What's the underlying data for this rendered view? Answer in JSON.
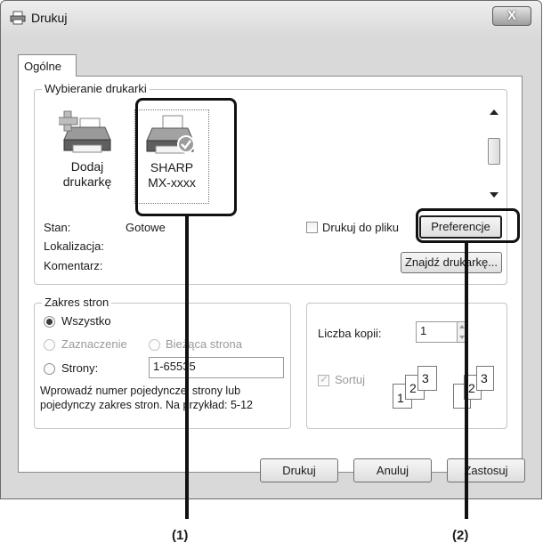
{
  "window": {
    "title": "Drukuj",
    "close_glyph": "X"
  },
  "tabs": [
    {
      "label": "Ogólne"
    }
  ],
  "printer_group": {
    "legend": "Wybieranie drukarki",
    "printers": [
      {
        "line1": "Dodaj",
        "line2": "drukarkę",
        "icon": "add-printer-icon"
      },
      {
        "line1": "SHARP",
        "line2": "MX-xxxx",
        "icon": "printer-default-icon"
      }
    ],
    "status_label": "Stan:",
    "status_value": "Gotowe",
    "location_label": "Lokalizacja:",
    "comment_label": "Komentarz:",
    "print_to_file_label": "Drukuj do pliku",
    "preferences_button": "Preferencje",
    "find_printer_button": "Znajdź drukarkę..."
  },
  "range_group": {
    "legend": "Zakres stron",
    "all_label": "Wszystko",
    "selection_label": "Zaznaczenie",
    "current_page_label": "Bieżąca strona",
    "pages_label": "Strony:",
    "pages_value": "1-65535",
    "hint": "Wprowadź numer pojedynczej strony lub pojedynczy zakres stron. Na przykład: 5-12"
  },
  "copies_group": {
    "copies_label": "Liczba kopii:",
    "copies_value": "1",
    "collate_label": "Sortuj",
    "collate_pages": [
      "1",
      "2",
      "3"
    ]
  },
  "footer": {
    "print": "Drukuj",
    "cancel": "Anuluj",
    "apply": "Zastosuj"
  },
  "callouts": [
    {
      "label": "(1)"
    },
    {
      "label": "(2)"
    }
  ]
}
